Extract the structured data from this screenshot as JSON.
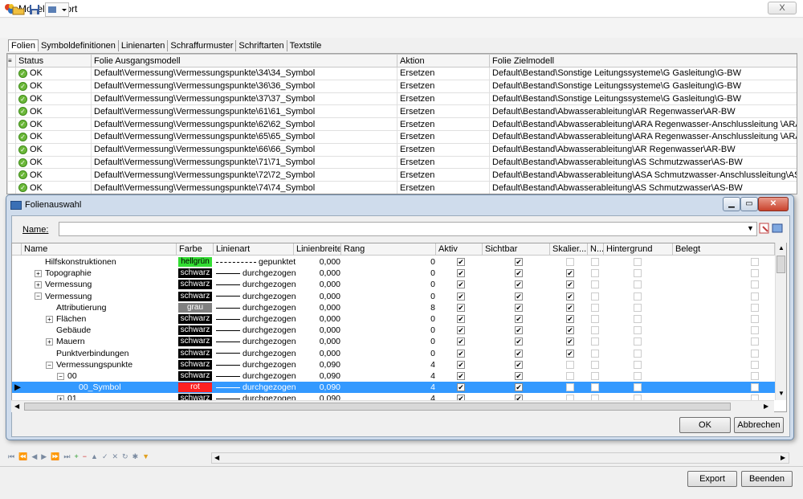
{
  "window": {
    "title": "Modell Export",
    "close_label": "X"
  },
  "toolbar": {
    "icons": [
      "open-folder-icon",
      "save-icon",
      "settings-dropdown-icon"
    ]
  },
  "tabs": [
    "Folien",
    "Symboldefinitionen",
    "Linienarten",
    "Schraffurmuster",
    "Schriftarten",
    "Textstile"
  ],
  "grid": {
    "columns": [
      "Status",
      "Folie Ausgangsmodell",
      "Aktion",
      "Folie Zielmodell"
    ],
    "rows": [
      [
        "OK",
        "Default\\Vermessung\\Vermessungspunkte\\34\\34_Symbol",
        "Ersetzen",
        "Default\\Bestand\\Sonstige Leitungssysteme\\G  Gasleitung\\G-BW"
      ],
      [
        "OK",
        "Default\\Vermessung\\Vermessungspunkte\\36\\36_Symbol",
        "Ersetzen",
        "Default\\Bestand\\Sonstige Leitungssysteme\\G  Gasleitung\\G-BW"
      ],
      [
        "OK",
        "Default\\Vermessung\\Vermessungspunkte\\37\\37_Symbol",
        "Ersetzen",
        "Default\\Bestand\\Sonstige Leitungssysteme\\G  Gasleitung\\G-BW"
      ],
      [
        "OK",
        "Default\\Vermessung\\Vermessungspunkte\\61\\61_Symbol",
        "Ersetzen",
        "Default\\Bestand\\Abwasserableitung\\AR  Regenwasser\\AR-BW"
      ],
      [
        "OK",
        "Default\\Vermessung\\Vermessungspunkte\\62\\62_Symbol",
        "Ersetzen",
        "Default\\Bestand\\Abwasserableitung\\ARA  Regenwasser-Anschlussleitung \\ARA-BW"
      ],
      [
        "OK",
        "Default\\Vermessung\\Vermessungspunkte\\65\\65_Symbol",
        "Ersetzen",
        "Default\\Bestand\\Abwasserableitung\\ARA  Regenwasser-Anschlussleitung \\ARA-BW"
      ],
      [
        "OK",
        "Default\\Vermessung\\Vermessungspunkte\\66\\66_Symbol",
        "Ersetzen",
        "Default\\Bestand\\Abwasserableitung\\AR  Regenwasser\\AR-BW"
      ],
      [
        "OK",
        "Default\\Vermessung\\Vermessungspunkte\\71\\71_Symbol",
        "Ersetzen",
        "Default\\Bestand\\Abwasserableitung\\AS  Schmutzwasser\\AS-BW"
      ],
      [
        "OK",
        "Default\\Vermessung\\Vermessungspunkte\\72\\72_Symbol",
        "Ersetzen",
        "Default\\Bestand\\Abwasserableitung\\ASA Schmutzwasser-Anschlussleitung\\ASA-BW"
      ],
      [
        "OK",
        "Default\\Vermessung\\Vermessungspunkte\\74\\74_Symbol",
        "Ersetzen",
        "Default\\Bestand\\Abwasserableitung\\AS  Schmutzwasser\\AS-BW"
      ]
    ]
  },
  "dialog": {
    "title": "Folienauswahl",
    "name_label": "Name:",
    "name_value": "",
    "columns": [
      "Name",
      "Farbe",
      "Linienart",
      "Linienbreite",
      "Rang",
      "Aktiv",
      "Sichtbar",
      "Skalier...",
      "N...",
      "Hintergrund",
      "Belegt"
    ],
    "rows": [
      {
        "name": "Hilfskonstruktionen",
        "indent": 1,
        "expander": "",
        "farbe": "hellgrün",
        "farbe_hex": "#33dd33",
        "farbe_text": "#000000",
        "linie": "gepunktet",
        "dashed": true,
        "breite": "0,000",
        "rang": "0",
        "aktiv": true,
        "sichtbar": true,
        "skal": false,
        "sel": false
      },
      {
        "name": "Topographie",
        "indent": 1,
        "expander": "+",
        "farbe": "schwarz",
        "farbe_hex": "#000000",
        "farbe_text": "#ffffff",
        "linie": "durchgezogen",
        "dashed": false,
        "breite": "0,000",
        "rang": "0",
        "aktiv": true,
        "sichtbar": true,
        "skal": true,
        "sel": false
      },
      {
        "name": "Vermessung",
        "indent": 1,
        "expander": "+",
        "farbe": "schwarz",
        "farbe_hex": "#000000",
        "farbe_text": "#ffffff",
        "linie": "durchgezogen",
        "dashed": false,
        "breite": "0,000",
        "rang": "0",
        "aktiv": true,
        "sichtbar": true,
        "skal": true,
        "sel": false
      },
      {
        "name": "Vermessung",
        "indent": 1,
        "expander": "−",
        "farbe": "schwarz",
        "farbe_hex": "#000000",
        "farbe_text": "#ffffff",
        "linie": "durchgezogen",
        "dashed": false,
        "breite": "0,000",
        "rang": "0",
        "aktiv": true,
        "sichtbar": true,
        "skal": true,
        "sel": false
      },
      {
        "name": "Attributierung",
        "indent": 2,
        "expander": "",
        "farbe": "grau",
        "farbe_hex": "#808080",
        "farbe_text": "#ffffff",
        "linie": "durchgezogen",
        "dashed": false,
        "breite": "0,000",
        "rang": "8",
        "aktiv": true,
        "sichtbar": true,
        "skal": true,
        "sel": false
      },
      {
        "name": "Flächen",
        "indent": 2,
        "expander": "+",
        "farbe": "schwarz",
        "farbe_hex": "#000000",
        "farbe_text": "#ffffff",
        "linie": "durchgezogen",
        "dashed": false,
        "breite": "0,000",
        "rang": "0",
        "aktiv": true,
        "sichtbar": true,
        "skal": true,
        "sel": false
      },
      {
        "name": "Gebäude",
        "indent": 2,
        "expander": "",
        "farbe": "schwarz",
        "farbe_hex": "#000000",
        "farbe_text": "#ffffff",
        "linie": "durchgezogen",
        "dashed": false,
        "breite": "0,000",
        "rang": "0",
        "aktiv": true,
        "sichtbar": true,
        "skal": true,
        "sel": false
      },
      {
        "name": "Mauern",
        "indent": 2,
        "expander": "+",
        "farbe": "schwarz",
        "farbe_hex": "#000000",
        "farbe_text": "#ffffff",
        "linie": "durchgezogen",
        "dashed": false,
        "breite": "0,000",
        "rang": "0",
        "aktiv": true,
        "sichtbar": true,
        "skal": true,
        "sel": false
      },
      {
        "name": "Punktverbindungen",
        "indent": 2,
        "expander": "",
        "farbe": "schwarz",
        "farbe_hex": "#000000",
        "farbe_text": "#ffffff",
        "linie": "durchgezogen",
        "dashed": false,
        "breite": "0,000",
        "rang": "0",
        "aktiv": true,
        "sichtbar": true,
        "skal": true,
        "sel": false
      },
      {
        "name": "Vermessungspunkte",
        "indent": 2,
        "expander": "−",
        "farbe": "schwarz",
        "farbe_hex": "#000000",
        "farbe_text": "#ffffff",
        "linie": "durchgezogen",
        "dashed": false,
        "breite": "0,090",
        "rang": "4",
        "aktiv": true,
        "sichtbar": true,
        "skal": false,
        "sel": false
      },
      {
        "name": "00",
        "indent": 3,
        "expander": "−",
        "farbe": "schwarz",
        "farbe_hex": "#000000",
        "farbe_text": "#ffffff",
        "linie": "durchgezogen",
        "dashed": false,
        "breite": "0,090",
        "rang": "4",
        "aktiv": true,
        "sichtbar": true,
        "skal": false,
        "sel": false
      },
      {
        "name": "00_Symbol",
        "indent": 4,
        "expander": "",
        "farbe": "rot",
        "farbe_hex": "#ff2020",
        "farbe_text": "#ffffff",
        "linie": "durchgezogen",
        "dashed": false,
        "breite": "0,090",
        "rang": "4",
        "aktiv": true,
        "sichtbar": true,
        "skal": false,
        "sel": true
      },
      {
        "name": "01",
        "indent": 3,
        "expander": "+",
        "farbe": "schwarz",
        "farbe_hex": "#000000",
        "farbe_text": "#ffffff",
        "linie": "durchgezogen",
        "dashed": false,
        "breite": "0,090",
        "rang": "4",
        "aktiv": true,
        "sichtbar": true,
        "skal": false,
        "sel": false
      }
    ],
    "ok_label": "OK",
    "cancel_label": "Abbrechen"
  },
  "footer": {
    "export_label": "Export",
    "close_label": "Beenden",
    "nav_icons": [
      "first-icon",
      "prev-page-icon",
      "prev-icon",
      "next-icon",
      "next-page-icon",
      "last-icon",
      "add-icon",
      "remove-icon",
      "move-up-icon",
      "confirm-icon",
      "cancel-icon",
      "refresh-icon",
      "asterisk-icon",
      "filter-icon"
    ]
  }
}
